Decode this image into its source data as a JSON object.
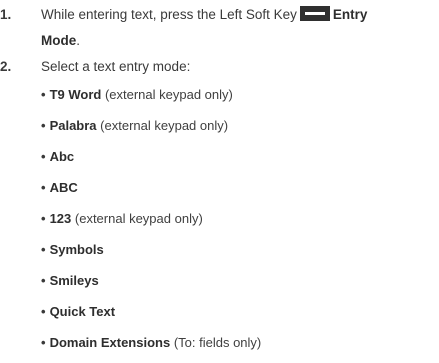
{
  "steps": [
    {
      "number": "1.",
      "line1_pre": "While entering text, press the Left Soft Key",
      "icon": "soft-key-dash-icon",
      "line1_bold": "Entry",
      "line2_bold": "Mode",
      "line2_rest": "."
    },
    {
      "number": "2.",
      "text": "Select a text entry mode:"
    }
  ],
  "bullet_char": "•",
  "modes": [
    {
      "name": "T9 Word",
      "note": "(external keypad only)"
    },
    {
      "name": "Palabra",
      "note": "(external keypad only)"
    },
    {
      "name": "Abc",
      "note": ""
    },
    {
      "name": "ABC",
      "note": ""
    },
    {
      "name": "123",
      "note": "(external keypad only)"
    },
    {
      "name": "Symbols",
      "note": ""
    },
    {
      "name": "Smileys",
      "note": ""
    },
    {
      "name": "Quick Text",
      "note": ""
    },
    {
      "name": "Domain Extensions",
      "note": "(To: fields only)"
    }
  ]
}
